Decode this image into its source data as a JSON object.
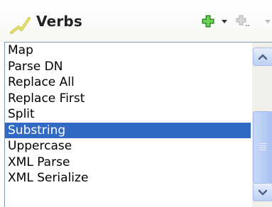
{
  "panel": {
    "title": "Verbs",
    "icon": "wand-icon",
    "toolbar": [
      {
        "name": "add-icon",
        "color": "#3aa52b"
      },
      {
        "name": "dropdown-arrow-icon"
      },
      {
        "name": "add-child-icon",
        "disabled": true
      },
      {
        "name": "dropdown-arrow-icon",
        "disabled": true
      }
    ]
  },
  "list": {
    "items": [
      "Map",
      "Parse DN",
      "Replace All",
      "Replace First",
      "Split",
      "Substring",
      "Uppercase",
      "XML Parse",
      "XML Serialize"
    ],
    "selected": "Substring",
    "selection_color": "#316ac5",
    "scroll_position": 0.78
  }
}
